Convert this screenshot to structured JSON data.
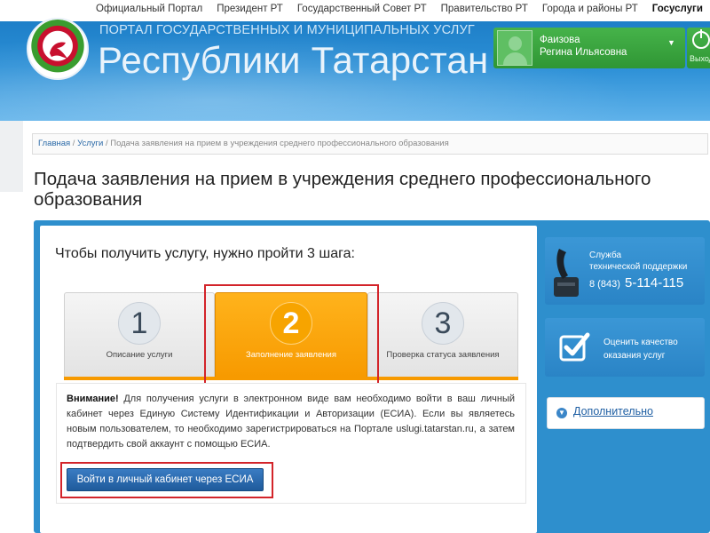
{
  "topnav": {
    "items": [
      "Официальный Портал",
      "Президент РТ",
      "Государственный Совет РТ",
      "Правительство РТ",
      "Города и районы РТ",
      "Госуслуги"
    ],
    "active": "Госуслуги"
  },
  "header": {
    "subtitle": "ПОРТАЛ ГОСУДАРСТВЕННЫХ И МУНИЦИПАЛЬНЫХ УСЛУГ",
    "title": "Республики Татарстан",
    "user": {
      "first": "Фаизова",
      "last": "Регина Ильясовна"
    },
    "logout_label": "Выход"
  },
  "breadcrumb": {
    "home": "Главная",
    "sep": " / ",
    "services": "Услуги",
    "current": "Подача заявления на прием в учреждения среднего профессионального образования"
  },
  "page_title": "Подача заявления на прием в учреждения среднего профессионального образования",
  "steps": {
    "heading": "Чтобы получить услугу, нужно пройти 3 шага:",
    "items": [
      {
        "number": "1",
        "label": "Описание услуги"
      },
      {
        "number": "2",
        "label": "Заполнение заявления"
      },
      {
        "number": "3",
        "label": "Проверка статуса заявления"
      }
    ],
    "active_index": 1
  },
  "notice": {
    "bold": "Внимание!",
    "text": " Для получения услуги в электронном виде вам необходимо войти в ваш личный кабинет через Единую Систему Идентификации и Авторизации (ЕСИА). Если вы являетесь новым пользователем, то необходимо зарегистрироваться на Портале uslugi.tatarstan.ru, а затем подтвердить свой аккаунт с помощью ЕСИА."
  },
  "esia_button": "Войти в личный кабинет через ЕСИА",
  "sidebar": {
    "support": {
      "line1": "Служба",
      "line2": "технической поддержки",
      "code": "8 (843)",
      "number": "5-114-115"
    },
    "rate": {
      "line1": "Оценить качество",
      "line2": "оказания услуг"
    },
    "extra": "Дополнительно"
  },
  "colors": {
    "accent_blue": "#2e8fcd",
    "active_step": "#f79a00",
    "user_green": "#3aa33f",
    "highlight_red": "#d3242a"
  },
  "icons": [
    "coat-of-arms-logo",
    "user-avatar-icon",
    "power-icon",
    "phone-icon",
    "checkbox-icon",
    "chevron-down-circle-icon"
  ]
}
